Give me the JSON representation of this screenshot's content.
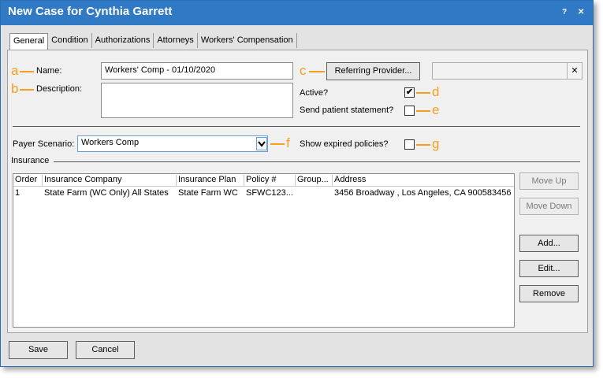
{
  "window": {
    "title": "New Case for Cynthia Garrett",
    "help_label": "?",
    "close_label": "✕"
  },
  "tabs": [
    {
      "label": "General"
    },
    {
      "label": "Condition"
    },
    {
      "label": "Authorizations"
    },
    {
      "label": "Attorneys"
    },
    {
      "label": "Workers' Compensation"
    }
  ],
  "form": {
    "name_label": "Name:",
    "name_value": "Workers' Comp - 01/10/2020",
    "description_label": "Description:",
    "description_value": "",
    "referring_provider_button": "Referring Provider...",
    "referring_provider_value": "",
    "clear_label": "✕",
    "active_label": "Active?",
    "active_checked": "✔",
    "send_statement_label": "Send patient statement?",
    "payer_scenario_label": "Payer Scenario:",
    "payer_scenario_value": "Workers Comp",
    "show_expired_label": "Show expired policies?"
  },
  "annotations": [
    "a",
    "b",
    "c",
    "d",
    "e",
    "f",
    "g"
  ],
  "insurance": {
    "section_label": "Insurance",
    "columns": [
      "Order",
      "Insurance Company",
      "Insurance Plan",
      "Policy #",
      "Group...",
      "Address"
    ],
    "rows": [
      [
        "1",
        "State Farm (WC Only) All States",
        "State Farm WC",
        "SFWC123...",
        "",
        "3456 Broadway , Los Angeles, CA 900583456"
      ]
    ],
    "buttons": {
      "move_up": "Move Up",
      "move_down": "Move Down",
      "add": "Add...",
      "edit": "Edit...",
      "remove": "Remove"
    }
  },
  "footer": {
    "save": "Save",
    "cancel": "Cancel"
  },
  "colors": {
    "titlebar": "#3079c4",
    "annotation": "#f5a021"
  }
}
